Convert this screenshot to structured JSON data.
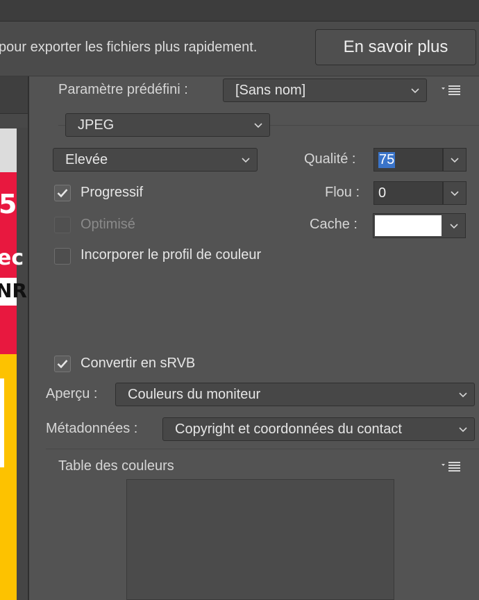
{
  "infobar": {
    "message": "pour exporter les fichiers plus rapidement.",
    "learn_more": "En savoir plus"
  },
  "preview_thumb": {
    "line1": "5",
    "line2": "ec",
    "line3": "NR"
  },
  "preset": {
    "label": "Paramètre prédéfini :",
    "value": "[Sans nom]"
  },
  "format": {
    "value": "JPEG"
  },
  "quality_preset": {
    "value": "Elevée"
  },
  "quality": {
    "label": "Qualité :",
    "value": "75"
  },
  "blur": {
    "label": "Flou :",
    "value": "0"
  },
  "matte": {
    "label": "Cache :",
    "color": "#ffffff"
  },
  "options": {
    "progressive": {
      "label": "Progressif",
      "checked": true
    },
    "optimized": {
      "label": "Optimisé",
      "checked": false,
      "disabled": true
    },
    "embed_profile": {
      "label": "Incorporer le profil de couleur",
      "checked": false
    },
    "convert_srgb": {
      "label": "Convertir en sRVB",
      "checked": true
    }
  },
  "preview": {
    "label": "Aperçu :",
    "value": "Couleurs du moniteur"
  },
  "metadata": {
    "label": "Métadonnées :",
    "value": "Copyright et coordonnées du contact"
  },
  "color_table": {
    "label": "Table des couleurs"
  },
  "icons": [
    "checkmark-icon",
    "chevron-down-icon",
    "panel-menu-icon"
  ],
  "colors": {
    "panel_bg": "#535353",
    "highlight": "#3a74c9",
    "thumb_red": "#e8183f",
    "thumb_yellow": "#fdc200"
  }
}
